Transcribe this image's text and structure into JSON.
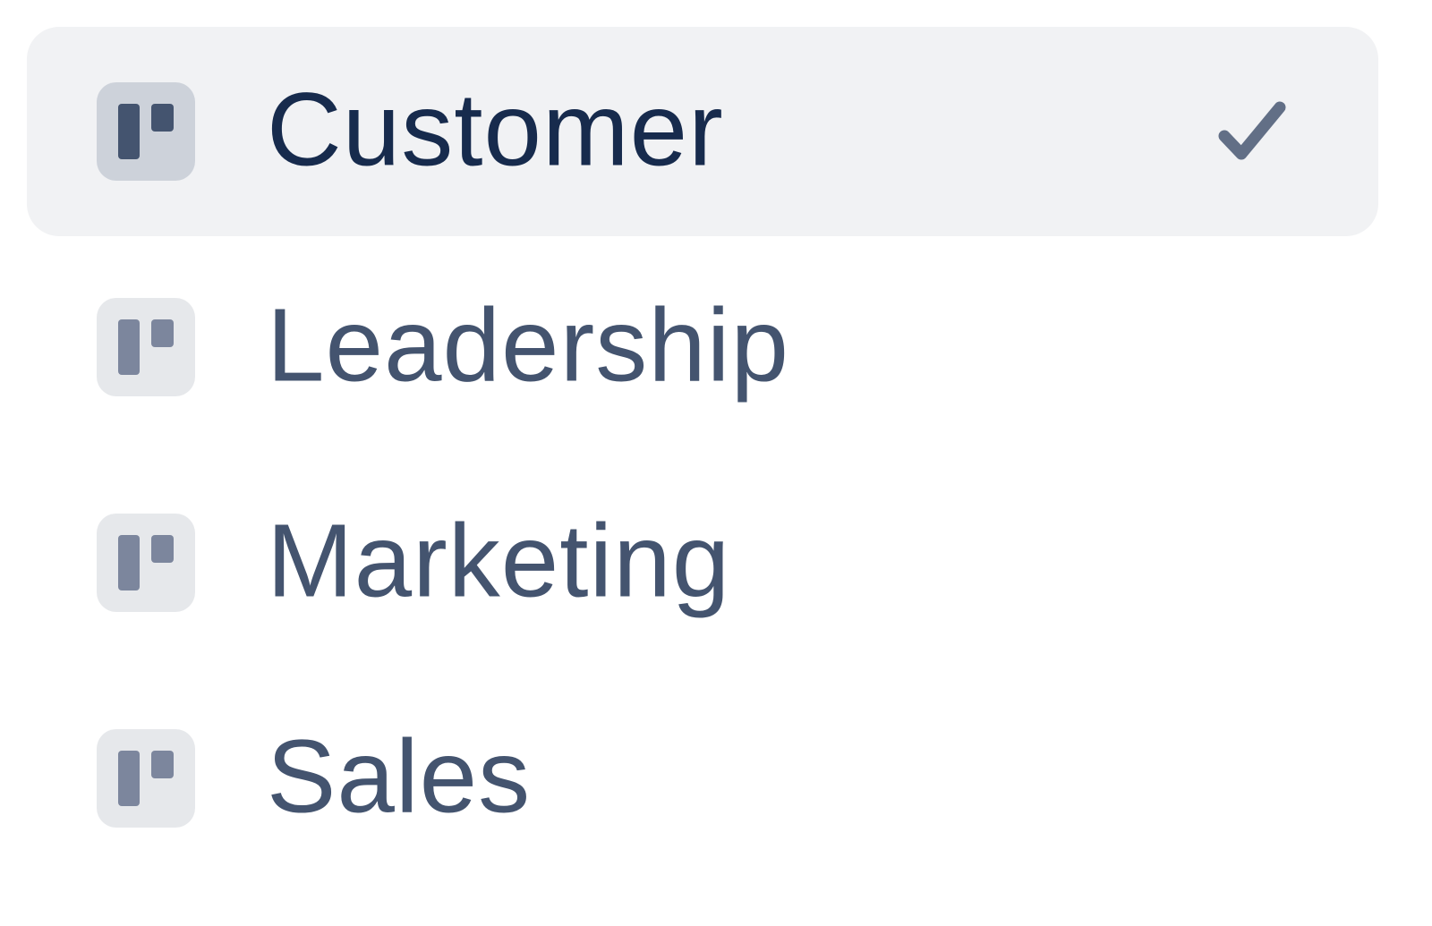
{
  "menu": {
    "items": [
      {
        "label": "Customer",
        "selected": true,
        "icon": "board-icon"
      },
      {
        "label": "Leadership",
        "selected": false,
        "icon": "board-icon"
      },
      {
        "label": "Marketing",
        "selected": false,
        "icon": "board-icon"
      },
      {
        "label": "Sales",
        "selected": false,
        "icon": "board-icon"
      }
    ],
    "selected_indicator": "checkmark-icon"
  },
  "colors": {
    "selected_background": "#f1f2f4",
    "selected_text": "#172b4d",
    "text": "#44546f",
    "icon_selected": "#44546f",
    "icon": "#7c869d",
    "checkmark": "#626f86"
  }
}
